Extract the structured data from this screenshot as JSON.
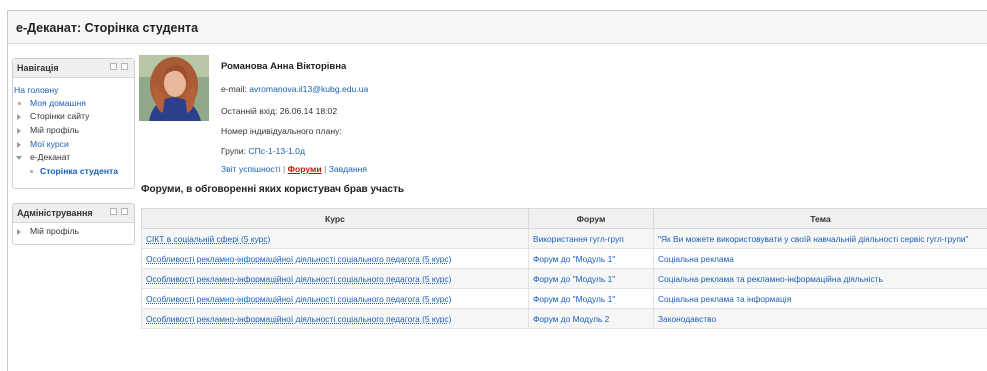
{
  "page": {
    "title": "е-Деканат: Сторінка студента"
  },
  "navigation": {
    "title": "Навігація",
    "home": "На головну",
    "items": [
      "Моя домашня",
      "Сторінки сайту",
      "Мій профіль",
      "Мої курси",
      "е-Деканат",
      "Сторінка студента"
    ]
  },
  "administration": {
    "title": "Адміністрування",
    "items": [
      "Мій профіль"
    ]
  },
  "student": {
    "name": "Романова Анна Вікторівна",
    "email_label": "e-mail:",
    "email": "avromanova.il13@kubg.edu.ua",
    "last_login": "Останній вхід: 26.06.14 18:02",
    "plan": "Номер індивідуального плану:",
    "groups_label": "Групи:",
    "group": "СПс-1-13-1.0д"
  },
  "links": {
    "report": "Звіт успішності",
    "forums": "Форуми",
    "tasks": "Завдання",
    "sep": "|"
  },
  "forums_section": {
    "title": "Форуми, в обговоренні яких користувач брав участь",
    "columns": [
      "Курс",
      "Форум",
      "Тема"
    ],
    "rows": [
      [
        "СІКТ в соціальній сфері (5 курс)",
        "Використання гугл-груп",
        "\"Як Ви можете використовувати у своїй навчальній діяльності сервіс гугл-групи\""
      ],
      [
        "Особливості рекламно-інформаційної діяльності соціального педагога (5 курс)",
        "Форум до \"Модуль 1\"",
        "Соціальна реклама"
      ],
      [
        "Особливості рекламно-інформаційної діяльності соціального педагога (5 курс)",
        "Форум до \"Модуль 1\"",
        "Соціальна реклама та рекламно-інформаційна діяльність"
      ],
      [
        "Особливості рекламно-інформаційної діяльності соціального педагога (5 курс)",
        "Форум до \"Модуль 1\"",
        "Соціальна реклама та інформація"
      ],
      [
        "Особливості рекламно-інформаційної діяльності соціального педагога (5 курс)",
        "Форум до Модуль 2",
        "Законодавство"
      ]
    ]
  }
}
